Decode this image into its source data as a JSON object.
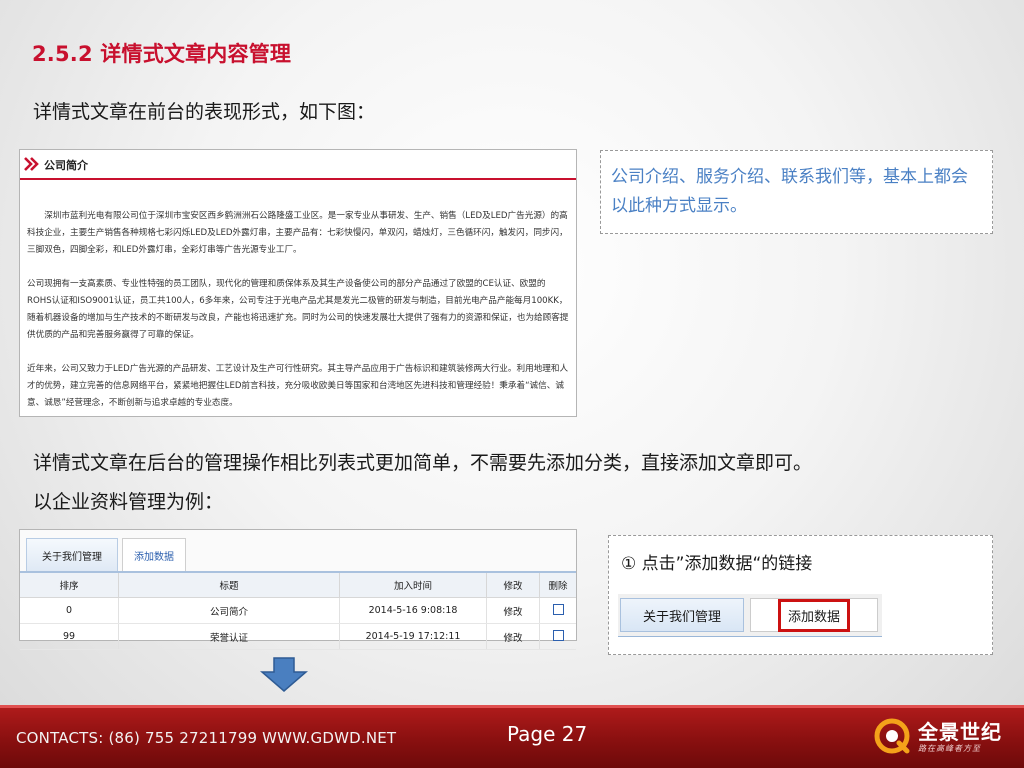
{
  "heading": "2.5.2 详情式文章内容管理",
  "intro_text": "详情式文章在前台的表现形式，如下图：",
  "article": {
    "title": "公司简介",
    "paragraphs": [
      "深圳市蓝利光电有限公司位于深圳市宝安区西乡鹤洲洲石公路隆盛工业区。是一家专业从事研发、生产、销售（LED及LED广告光源）的高科技企业，主要生产销售各种规格七彩闪烁LED及LED外露灯串，主要产品有：七彩快慢闪，单双闪，蜡烛灯，三色循环闪，触发闪，同步闪，三脚双色，四脚全彩，和LED外露灯串，全彩灯串等广告光源专业工厂。",
      "公司现拥有一支高素质、专业性特强的员工团队，现代化的管理和质保体系及其生产设备使公司的部分产品通过了欧盟的CE认证、欧盟的ROHS认证和ISO9001认证，员工共100人，6多年来，公司专注于光电产品尤其是发光二极管的研发与制造，目前光电产品产能每月100KK，随着机器设备的增加与生产技术的不断研发与改良，产能也将迅速扩充。同时为公司的快速发展壮大提供了强有力的资源和保证，也为给顾客提供优质的产品和完善服务赢得了可靠的保证。",
      "近年来，公司又致力于LED广告光源的产品研发、工艺设计及生产可行性研究。其主导产品应用于广告标识和建筑装修两大行业。利用地理和人才的优势，建立完善的信息网络平台，紧紧地把握住LED前言科技，充分吸收欧美日等国家和台湾地区先进科技和管理经验！秉承着“诚信、诚意、诚恳”经营理念，不断创新与追求卓越的专业态度。"
    ]
  },
  "note1_text": "公司介绍、服务介绍、联系我们等，基本上都会以此种方式显示。",
  "backend_text_1": "详情式文章在后台的管理操作相比列表式更加简单，不需要先添加分类，直接添加文章即可。",
  "backend_text_2": "以企业资料管理为例：",
  "admin": {
    "tabs": [
      "关于我们管理",
      "添加数据"
    ],
    "columns": [
      "排序",
      "标题",
      "加入时间",
      "修改",
      "删除"
    ],
    "rows": [
      {
        "order": "0",
        "title": "公司简介",
        "time": "2014-5-16 9:08:18",
        "edit": "修改"
      },
      {
        "order": "99",
        "title": "荣誉认证",
        "time": "2014-5-19 17:12:11",
        "edit": "修改"
      }
    ]
  },
  "note2": {
    "text": "① 点击”添加数据“的链接",
    "tabs": [
      "关于我们管理",
      "添加数据"
    ],
    "highlight_color": "#cc1111"
  },
  "footer": {
    "contacts": "CONTACTS: (86) 755 27211799 WWW.GDWD.NET",
    "page": "Page 27",
    "brand": "全景世纪",
    "slogan": "路在高峰者方至"
  },
  "colors": {
    "heading": "#c8102e",
    "note_text": "#4a80c4",
    "footer_bg": "#8a1010"
  }
}
